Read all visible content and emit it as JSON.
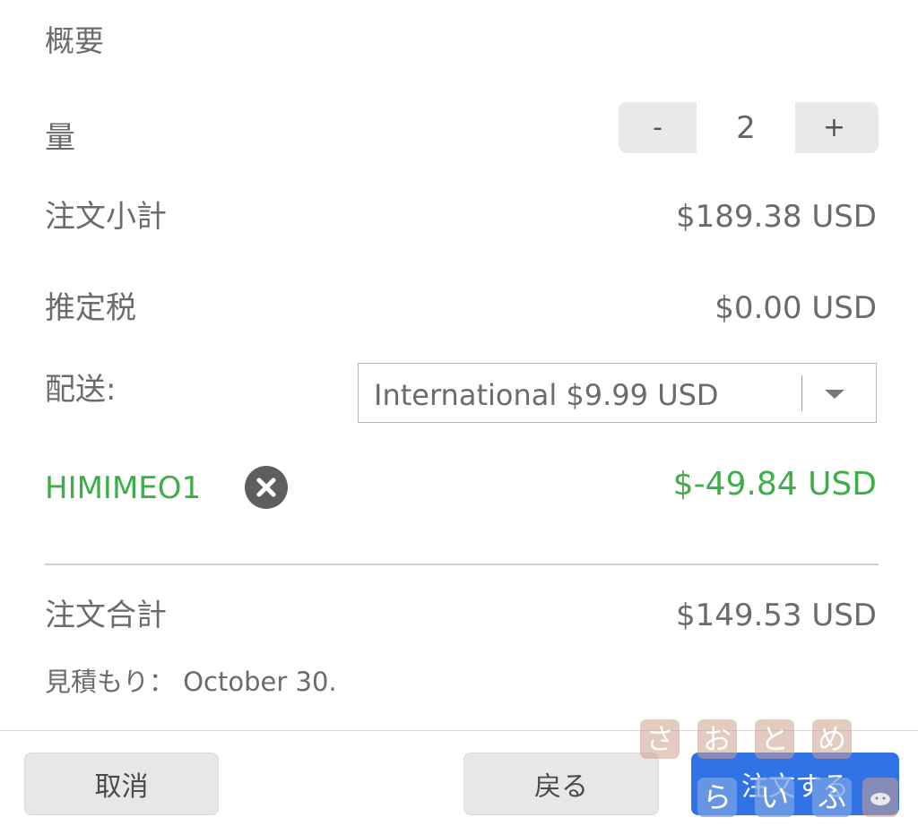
{
  "summary": {
    "title": "概要"
  },
  "quantity": {
    "label": "量",
    "decrement": "-",
    "value": "2",
    "increment": "+"
  },
  "subtotal": {
    "label": "注文小計",
    "value": "$189.38 USD"
  },
  "tax": {
    "label": "推定税",
    "value": "$0.00 USD"
  },
  "shipping": {
    "label": "配送:",
    "selected": "International $9.99 USD"
  },
  "coupon": {
    "code": "HIMIMEO1",
    "discount": "$-49.84 USD"
  },
  "total": {
    "label": "注文合計",
    "value": "$149.53 USD"
  },
  "estimate": {
    "text": "見積もり： October 30."
  },
  "footer": {
    "cancel": "取消",
    "back": "戻る",
    "order": "注文する"
  },
  "watermark": {
    "row1": [
      "さ",
      "お",
      "と",
      "め"
    ],
    "row2": [
      "ら",
      "い",
      "ふ"
    ]
  },
  "colors": {
    "text": "#6b6b6b",
    "discount_green": "#3fae49",
    "primary_blue": "#2f73e6",
    "stepper_bg": "#e9e9e9"
  }
}
